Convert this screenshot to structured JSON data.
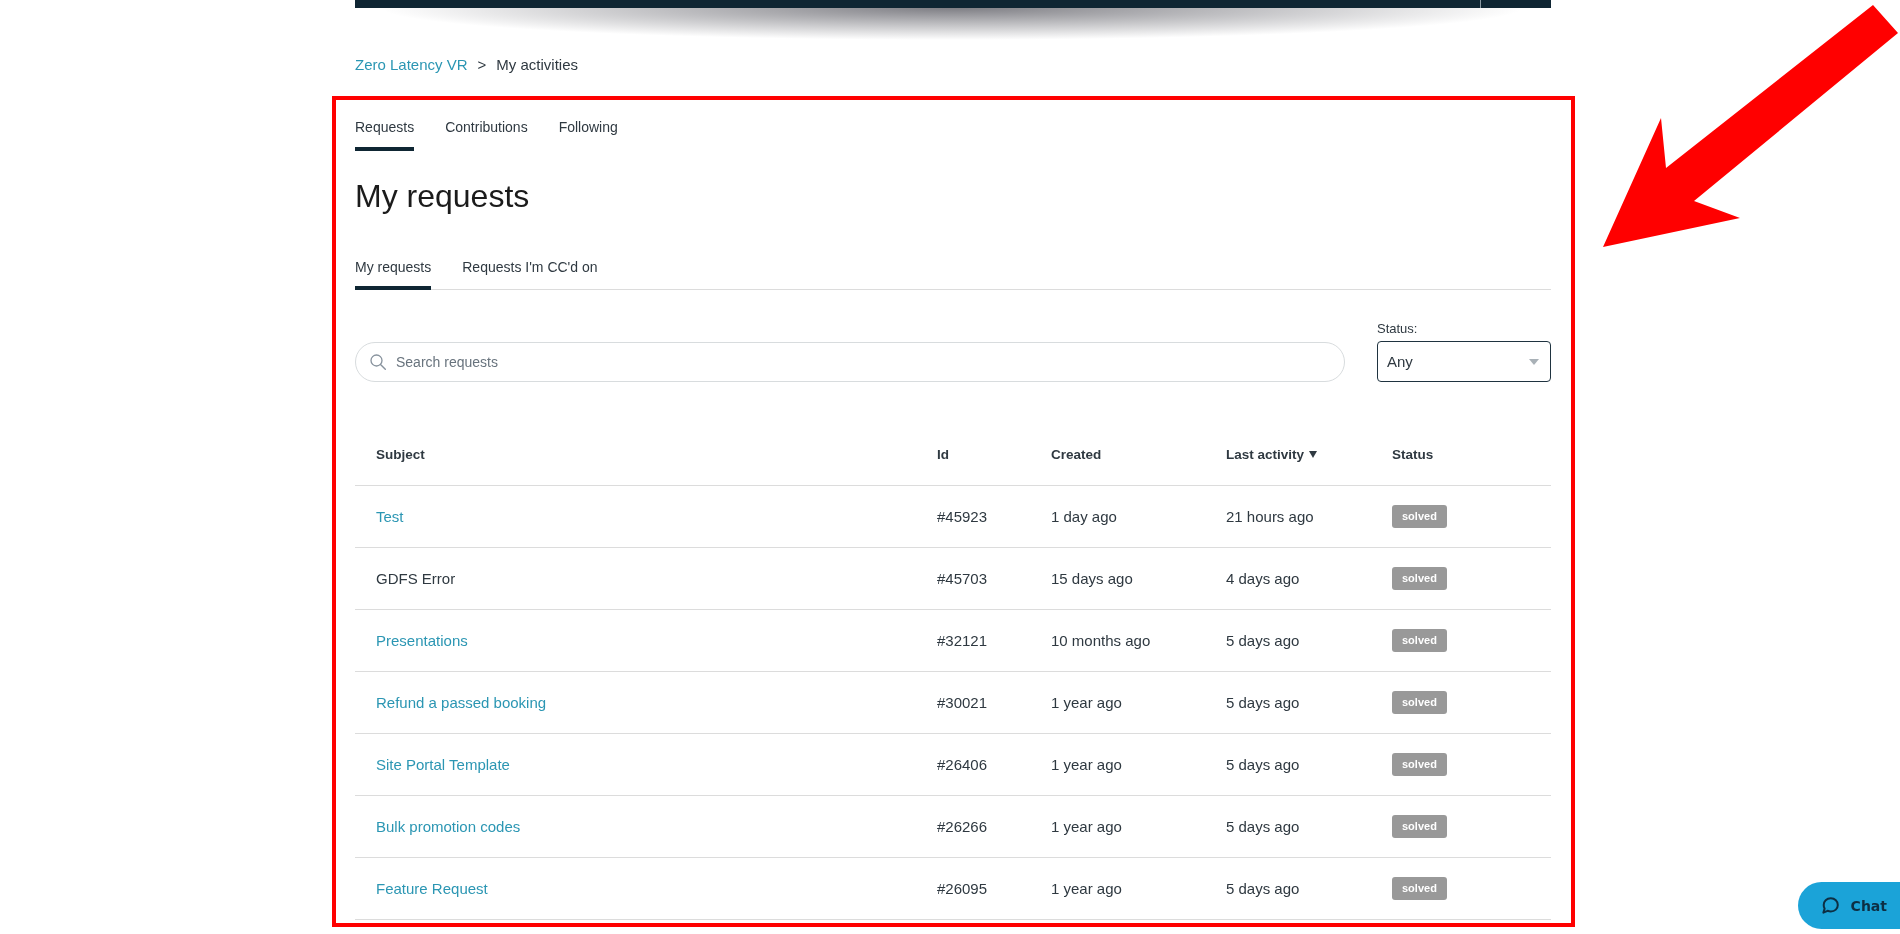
{
  "breadcrumb": {
    "items": [
      {
        "label": "Zero Latency VR",
        "kind": "link"
      },
      {
        "label": "My activities",
        "kind": "current"
      }
    ],
    "separator": ">"
  },
  "activity_tabs": [
    {
      "label": "Requests",
      "selected": true
    },
    {
      "label": "Contributions",
      "selected": false
    },
    {
      "label": "Following",
      "selected": false
    }
  ],
  "title": "My requests",
  "request_tabs": [
    {
      "label": "My requests",
      "selected": true
    },
    {
      "label": "Requests I'm CC'd on",
      "selected": false
    }
  ],
  "search": {
    "placeholder": "Search requests"
  },
  "status_filter": {
    "label": "Status:",
    "value": "Any"
  },
  "table": {
    "columns": [
      {
        "label": "Subject",
        "sorted": false
      },
      {
        "label": "Id",
        "sorted": false
      },
      {
        "label": "Created",
        "sorted": false
      },
      {
        "label": "Last activity",
        "sorted": true
      },
      {
        "label": "Status",
        "sorted": false
      }
    ],
    "rows": [
      {
        "subject": "Test",
        "hovered": false,
        "id": "#45923",
        "created": "1 day ago",
        "last_activity": "21 hours ago",
        "status": "solved"
      },
      {
        "subject": "GDFS Error",
        "hovered": true,
        "id": "#45703",
        "created": "15 days ago",
        "last_activity": "4 days ago",
        "status": "solved"
      },
      {
        "subject": "Presentations",
        "hovered": false,
        "id": "#32121",
        "created": "10 months ago",
        "last_activity": "5 days ago",
        "status": "solved"
      },
      {
        "subject": "Refund a passed booking",
        "hovered": false,
        "id": "#30021",
        "created": "1 year ago",
        "last_activity": "5 days ago",
        "status": "solved"
      },
      {
        "subject": "Site Portal Template",
        "hovered": false,
        "id": "#26406",
        "created": "1 year ago",
        "last_activity": "5 days ago",
        "status": "solved"
      },
      {
        "subject": "Bulk promotion codes",
        "hovered": false,
        "id": "#26266",
        "created": "1 year ago",
        "last_activity": "5 days ago",
        "status": "solved"
      },
      {
        "subject": "Feature Request",
        "hovered": false,
        "id": "#26095",
        "created": "1 year ago",
        "last_activity": "5 days ago",
        "status": "solved"
      }
    ]
  },
  "chat_button": {
    "label": "Chat"
  }
}
